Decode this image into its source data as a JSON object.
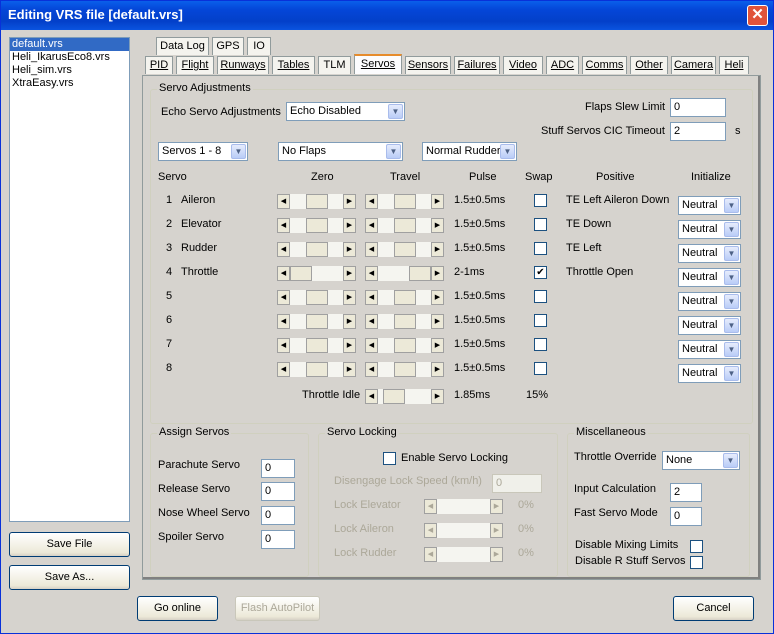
{
  "window": {
    "title": "Editing VRS file [default.vrs]",
    "close": "✕"
  },
  "files": [
    "default.vrs",
    "Heli_IkarusEco8.vrs",
    "Heli_sim.vrs",
    "XtraEasy.vrs"
  ],
  "buttons": {
    "save_file": "Save File",
    "save_as": "Save As...",
    "go_online": "Go online",
    "flash_autopilot": "Flash AutoPilot",
    "cancel": "Cancel"
  },
  "tabs_row1": [
    "Data Log",
    "GPS",
    "IO"
  ],
  "tabs_row2": [
    "PID",
    "Flight",
    "Runways",
    "Tables",
    "TLM",
    "Servos",
    "Sensors",
    "Failures",
    "Video",
    "ADC",
    "Comms",
    "Other",
    "Camera",
    "Heli"
  ],
  "servo_adj": {
    "group_title": "Servo Adjustments",
    "echo_label": "Echo Servo Adjustments",
    "echo_value": "Echo Disabled",
    "flaps_slew_label": "Flaps Slew Limit",
    "flaps_slew_value": "0",
    "cic_label": "Stuff Servos CIC Timeout",
    "cic_value": "2",
    "cic_unit": "s",
    "servo_range": "Servos 1 - 8",
    "flaps_mode": "No Flaps",
    "rudder_mode": "Normal Rudder"
  },
  "headers": {
    "servo": "Servo",
    "zero": "Zero",
    "travel": "Travel",
    "pulse": "Pulse",
    "swap": "Swap",
    "positive": "Positive",
    "initialize": "Initialize"
  },
  "servos": [
    {
      "num": "1",
      "name": "Aileron",
      "pulse": "1.5±0.5ms",
      "swap": false,
      "positive": "TE Left Aileron Down",
      "init": "Neutral",
      "zero": 0.5,
      "travel": 0.5
    },
    {
      "num": "2",
      "name": "Elevator",
      "pulse": "1.5±0.5ms",
      "swap": false,
      "positive": "TE Down",
      "init": "Neutral",
      "zero": 0.5,
      "travel": 0.5
    },
    {
      "num": "3",
      "name": "Rudder",
      "pulse": "1.5±0.5ms",
      "swap": false,
      "positive": "TE Left",
      "init": "Neutral",
      "zero": 0.5,
      "travel": 0.5
    },
    {
      "num": "4",
      "name": "Throttle",
      "pulse": "2-1ms",
      "swap": true,
      "positive": "Throttle Open",
      "init": "Neutral",
      "zero": 0.0,
      "travel": 1.0
    },
    {
      "num": "5",
      "name": "",
      "pulse": "1.5±0.5ms",
      "swap": false,
      "positive": "",
      "init": "Neutral",
      "zero": 0.5,
      "travel": 0.5
    },
    {
      "num": "6",
      "name": "",
      "pulse": "1.5±0.5ms",
      "swap": false,
      "positive": "",
      "init": "Neutral",
      "zero": 0.5,
      "travel": 0.5
    },
    {
      "num": "7",
      "name": "",
      "pulse": "1.5±0.5ms",
      "swap": false,
      "positive": "",
      "init": "Neutral",
      "zero": 0.5,
      "travel": 0.5
    },
    {
      "num": "8",
      "name": "",
      "pulse": "1.5±0.5ms",
      "swap": false,
      "positive": "",
      "init": "Neutral",
      "zero": 0.5,
      "travel": 0.5
    }
  ],
  "throttle_idle": {
    "label": "Throttle Idle",
    "pulse": "1.85ms",
    "percent": "15%",
    "level": 0.15
  },
  "assign": {
    "title": "Assign Servos",
    "items": [
      {
        "label": "Parachute Servo",
        "value": "0"
      },
      {
        "label": "Release Servo",
        "value": "0"
      },
      {
        "label": "Nose Wheel Servo",
        "value": "0"
      },
      {
        "label": "Spoiler Servo",
        "value": "0"
      }
    ]
  },
  "locking": {
    "title": "Servo Locking",
    "enable_label": "Enable Servo Locking",
    "speed_label": "Disengage Lock Speed (km/h)",
    "speed_value": "0",
    "items": [
      {
        "label": "Lock Elevator",
        "pct": "0%"
      },
      {
        "label": "Lock Aileron",
        "pct": "0%"
      },
      {
        "label": "Lock Rudder",
        "pct": "0%"
      }
    ]
  },
  "misc": {
    "title": "Miscellaneous",
    "throttle_override_label": "Throttle Override",
    "throttle_override_value": "None",
    "input_calc_label": "Input Calculation",
    "input_calc_value": "2",
    "fast_servo_label": "Fast Servo Mode",
    "fast_servo_value": "0",
    "disable_mixing_label": "Disable Mixing Limits",
    "disable_r_stuff_label": "Disable R Stuff Servos"
  }
}
